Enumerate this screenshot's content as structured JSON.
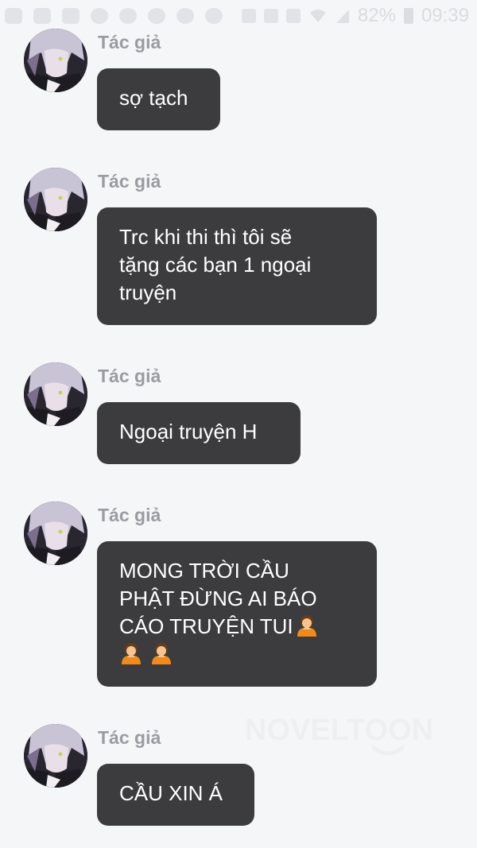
{
  "status_bar": {
    "battery": "82%",
    "time": "09:39"
  },
  "messages": [
    {
      "author": "Tác giả",
      "lines": [
        "sợ tạch"
      ]
    },
    {
      "author": "Tác giả",
      "lines": [
        "Trc khi thi thì tôi sẽ",
        "tặng các bạn 1 ngoại",
        "truyện"
      ]
    },
    {
      "author": "Tác giả",
      "lines": [
        "Ngoại truyện H"
      ]
    },
    {
      "author": "Tác giả",
      "lines": [
        "MONG TRỜI CẦU",
        "PHẬT ĐỪNG AI BÁO",
        "CÁO TRUYỆN TUI"
      ]
    },
    {
      "author": "Tác giả",
      "lines": [
        "CẦU XIN Á"
      ]
    }
  ],
  "watermark": "NOVELTOON",
  "icons": [
    "notification-icons",
    "wifi-icon",
    "signal-icon",
    "battery-icon",
    "author-avatar",
    "bowing-person-emoji"
  ]
}
